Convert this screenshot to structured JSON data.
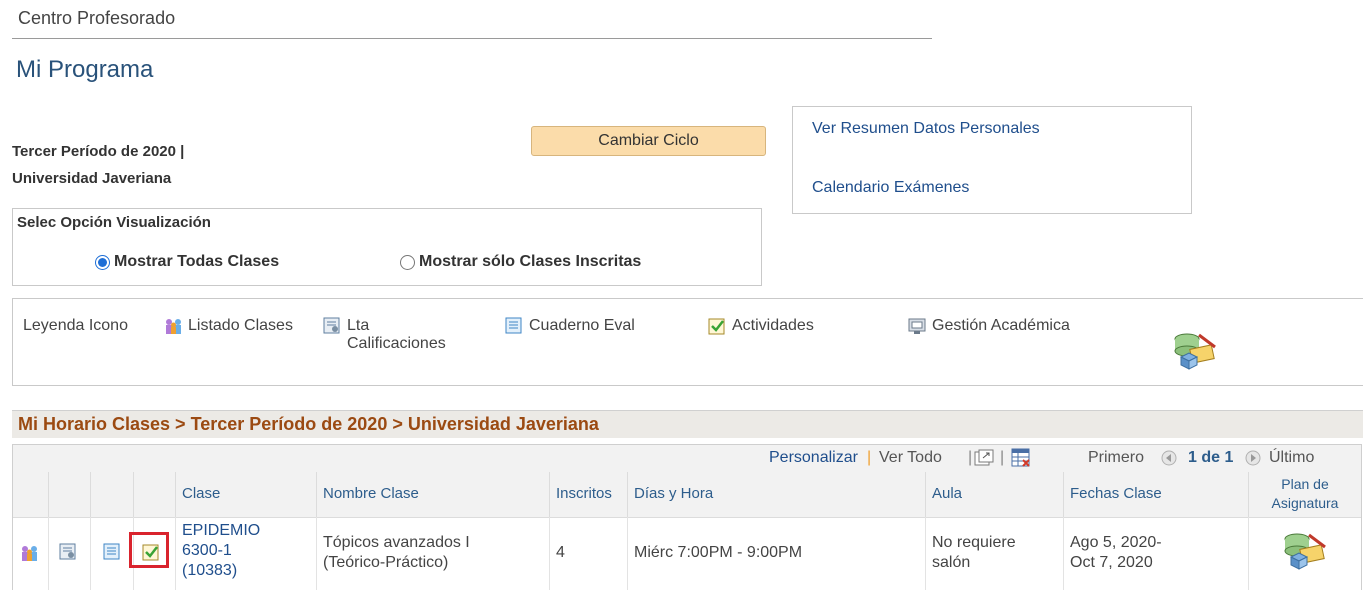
{
  "header": {
    "section": "Centro Profesorado",
    "title": "Mi Programa"
  },
  "term": {
    "line1": "Tercer Período de 2020 |",
    "line2": "Universidad Javeriana",
    "change_button": "Cambiar Ciclo"
  },
  "links": {
    "personal": "Ver Resumen Datos Personales",
    "exams": "Calendario Exámenes"
  },
  "view_options": {
    "title": "Selec Opción Visualización",
    "options": [
      {
        "label": "Mostrar Todas Clases",
        "selected": true
      },
      {
        "label": "Mostrar sólo Clases Inscritas",
        "selected": false
      }
    ]
  },
  "legend": {
    "label": "Leyenda Icono",
    "items": [
      {
        "label": "Listado Clases",
        "icon": "people-icon"
      },
      {
        "label": "Lta Calificaciones",
        "icon": "grade-roster-icon"
      },
      {
        "label": "Cuaderno Eval",
        "icon": "gradebook-icon"
      },
      {
        "label": "Actividades",
        "icon": "checklist-icon"
      },
      {
        "label": "Gestión Académica",
        "icon": "academic-management-icon"
      }
    ],
    "extra_icon": "syllabus-plan-icon"
  },
  "schedule": {
    "title": "Mi Horario Clases > Tercer Período de 2020 > Universidad Javeriana",
    "nav": {
      "personalize": "Personalizar",
      "view_all": "Ver Todo",
      "first": "Primero",
      "page": "1 de 1",
      "last": "Último"
    },
    "columns": [
      "Clase",
      "Nombre Clase",
      "Inscritos",
      "Días y Hora",
      "Aula",
      "Fechas Clase",
      "Plan de Asignatura"
    ],
    "rows": [
      {
        "class_code": [
          "EPIDEMIO",
          "6300-1",
          "(10383)"
        ],
        "class_name": [
          "Tópicos avanzados I",
          "(Teórico-Práctico)"
        ],
        "enrolled": "4",
        "days_time": "Miérc 7:00PM - 9:00PM",
        "room": [
          "No requiere",
          "salón"
        ],
        "dates": [
          "Ago 5, 2020-",
          "Oct 7, 2020"
        ]
      }
    ]
  },
  "colors": {
    "title_blue": "#29527a",
    "link_blue": "#1f4e8c",
    "grid_title_orange": "#9b4a12",
    "button_fill": "#fbdcaa",
    "highlight_red": "#d9232d"
  }
}
